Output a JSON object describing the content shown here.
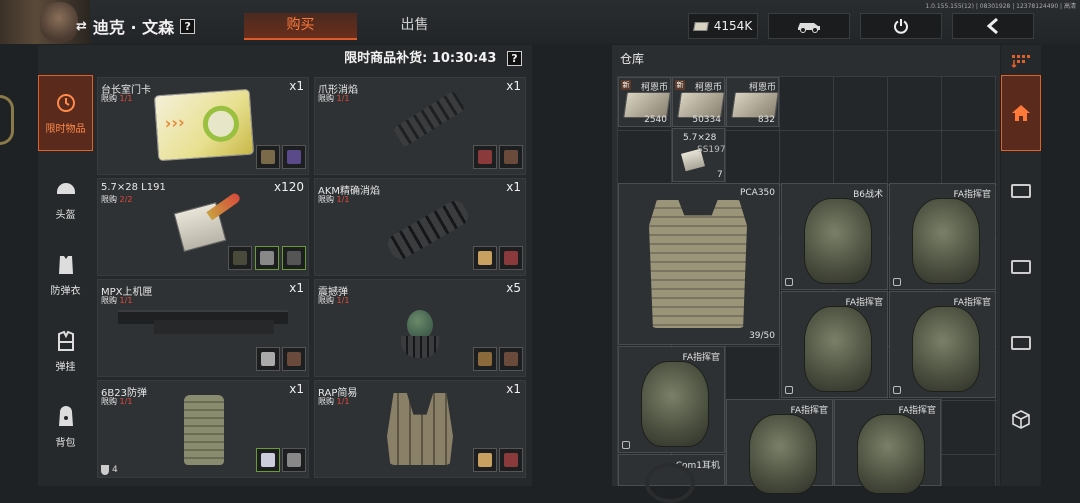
{
  "header": {
    "player_name": "迪克 · 文森",
    "help_label": "?",
    "version_text": "1.0.155.155(12) | 08301928 | 12378124490 | 高清",
    "tabs": [
      {
        "label": "购买"
      },
      {
        "label": "出售"
      }
    ],
    "currency_amount": "4154K"
  },
  "shop": {
    "refresh_text": "限时商品补货: 10:30:43",
    "help_label": "?",
    "categories": [
      {
        "label": "限时物品",
        "icon": "clock-icon"
      },
      {
        "label": "头盔",
        "icon": "helmet-icon"
      },
      {
        "label": "防弹衣",
        "icon": "vest-icon"
      },
      {
        "label": "弹挂",
        "icon": "rig-icon"
      },
      {
        "label": "背包",
        "icon": "backpack-icon"
      }
    ],
    "items": [
      {
        "name": "台长室门卡",
        "limit_label": "限购",
        "limit": "1/1",
        "qty": "x1"
      },
      {
        "name": "爪形消焰",
        "limit_label": "限购",
        "limit": "1/1",
        "qty": "x1"
      },
      {
        "name": "5.7×28 L191",
        "limit_label": "限购",
        "limit": "2/2",
        "qty": "x120"
      },
      {
        "name": "AKM精确消焰",
        "limit_label": "限购",
        "limit": "1/1",
        "qty": "x1"
      },
      {
        "name": "MPX上机匣",
        "limit_label": "限购",
        "limit": "1/1",
        "qty": "x1"
      },
      {
        "name": "震撼弹",
        "limit_label": "限购",
        "limit": "1/1",
        "qty": "x5"
      },
      {
        "name": "6B23防弹",
        "limit_label": "限购",
        "limit": "1/1",
        "qty": "x1",
        "armor_class": "4"
      },
      {
        "name": "RAP简易",
        "limit_label": "限购",
        "limit": "1/1",
        "qty": "x1"
      }
    ]
  },
  "warehouse": {
    "title": "仓库",
    "new_badge": "新",
    "cash": [
      {
        "label": "柯恩币",
        "count": "2540"
      },
      {
        "label": "柯恩币",
        "count": "50334"
      },
      {
        "label": "柯恩币",
        "count": "832"
      }
    ],
    "ammo": {
      "label": "5.7×28",
      "sub": "SS197",
      "count": "7"
    },
    "vest": {
      "label": "PCA350",
      "durability": "39/50"
    },
    "bags": [
      {
        "label": "B6战术"
      },
      {
        "label": "FA指挥官"
      },
      {
        "label": "FA指挥官"
      },
      {
        "label": "FA指挥官"
      },
      {
        "label": "FA指挥官"
      },
      {
        "label": "FA指挥官"
      },
      {
        "label": "FA指挥官"
      }
    ],
    "headset": {
      "label": "Com1耳机"
    }
  },
  "colors": {
    "accent": "#e0602a",
    "limit_red": "#e24a3a",
    "bg": "#1f2224"
  }
}
